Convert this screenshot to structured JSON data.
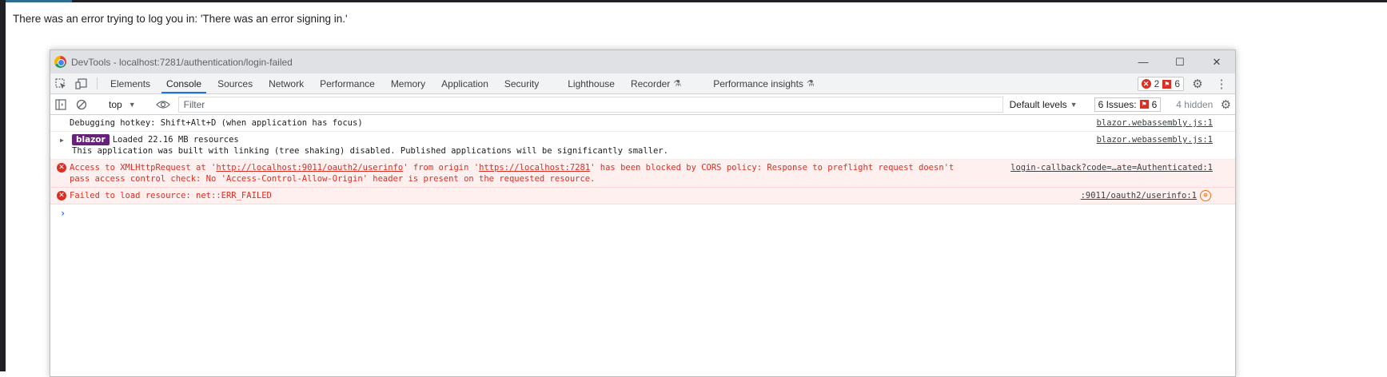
{
  "page": {
    "message": "There was an error trying to log you in: 'There was an error signing in.'"
  },
  "window": {
    "title": "DevTools - localhost:7281/authentication/login-failed",
    "minimize": "—",
    "maximize": "☐",
    "close": "✕"
  },
  "tabs": [
    {
      "label": "Elements"
    },
    {
      "label": "Console",
      "active": true
    },
    {
      "label": "Sources"
    },
    {
      "label": "Network"
    },
    {
      "label": "Performance"
    },
    {
      "label": "Memory"
    },
    {
      "label": "Application"
    },
    {
      "label": "Security"
    },
    {
      "label": "Lighthouse"
    },
    {
      "label": "Recorder"
    },
    {
      "label": "Performance insights"
    }
  ],
  "toolbar": {
    "error_count": "2",
    "issue_count": "6"
  },
  "filterbar": {
    "context": "top",
    "filter_placeholder": "Filter",
    "levels": "Default levels",
    "issues_label": "6 Issues:",
    "issues_count": "6",
    "hidden": "4 hidden"
  },
  "console": {
    "rows": [
      {
        "text": "Debugging hotkey: Shift+Alt+D (when application has focus)",
        "source": "blazor.webassembly.js:1"
      },
      {
        "badge": "blazor",
        "text": "Loaded 22.16 MB resources",
        "text2": "This application was built with linking (tree shaking) disabled. Published applications will be significantly smaller.",
        "source": "blazor.webassembly.js:1"
      },
      {
        "type": "error",
        "text_a": "Access to XMLHttpRequest at '",
        "url1": "http://localhost:9011/oauth2/userinfo",
        "text_b": "' from origin '",
        "url2": "https://localhost:7281",
        "text_c": "' has been blocked by CORS policy: Response to preflight request doesn't",
        "text2": "pass access control check: No 'Access-Control-Allow-Origin' header is present on the requested resource.",
        "source": "login-callback?code=…ate=Authenticated:1"
      },
      {
        "type": "error",
        "text": "Failed to load resource: net::ERR_FAILED",
        "source": ":9011/oauth2/userinfo:1"
      }
    ],
    "prompt": "›"
  },
  "colors": {
    "error_red": "#d93025",
    "active_tab_blue": "#1a73e8",
    "blazor_purple": "#68217a"
  }
}
